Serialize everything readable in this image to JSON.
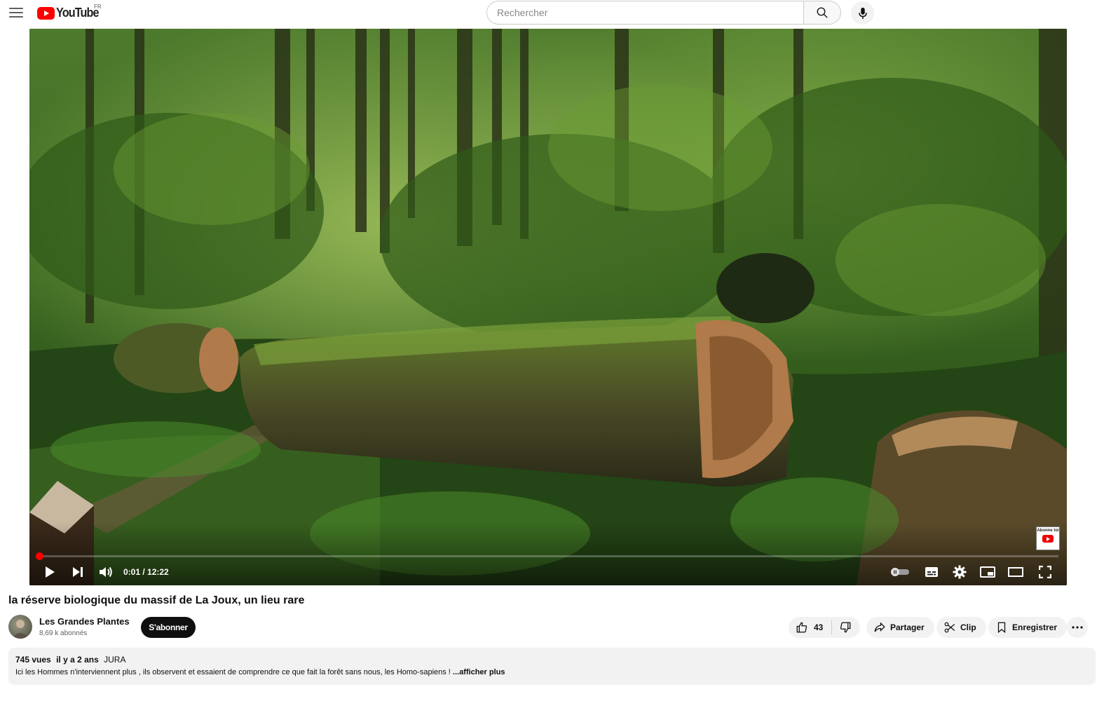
{
  "header": {
    "logo_text": "YouTube",
    "country_code": "FR",
    "search_placeholder": "Rechercher"
  },
  "player": {
    "current_time": "0:01",
    "duration": "12:22",
    "time_display": "0:01 / 12:22",
    "progress_fraction": 0.0014,
    "badge_text": "Abonne toi"
  },
  "video": {
    "title": "la réserve biologique du massif de La Joux, un lieu rare",
    "channel": "Les Grandes Plantes",
    "subscribers": "8,69 k abonnés",
    "subscribe_label": "S'abonner",
    "likes": "43",
    "share_label": "Partager",
    "clip_label": "Clip",
    "save_label": "Enregistrer"
  },
  "description": {
    "views": "745 vues",
    "date": "il y a 2 ans",
    "hashtag": "JURA",
    "text": "Ici les Hommes n'interviennent plus , ils observent et essaient de comprendre ce que fait la forêt sans nous, les Homo-sapiens !",
    "more_label": "...afficher plus"
  },
  "colors": {
    "brand_red": "#ff0000",
    "progress_red": "#ff0000",
    "subscribe_bg": "#0f0f0f",
    "pill_bg": "#f2f2f2"
  }
}
